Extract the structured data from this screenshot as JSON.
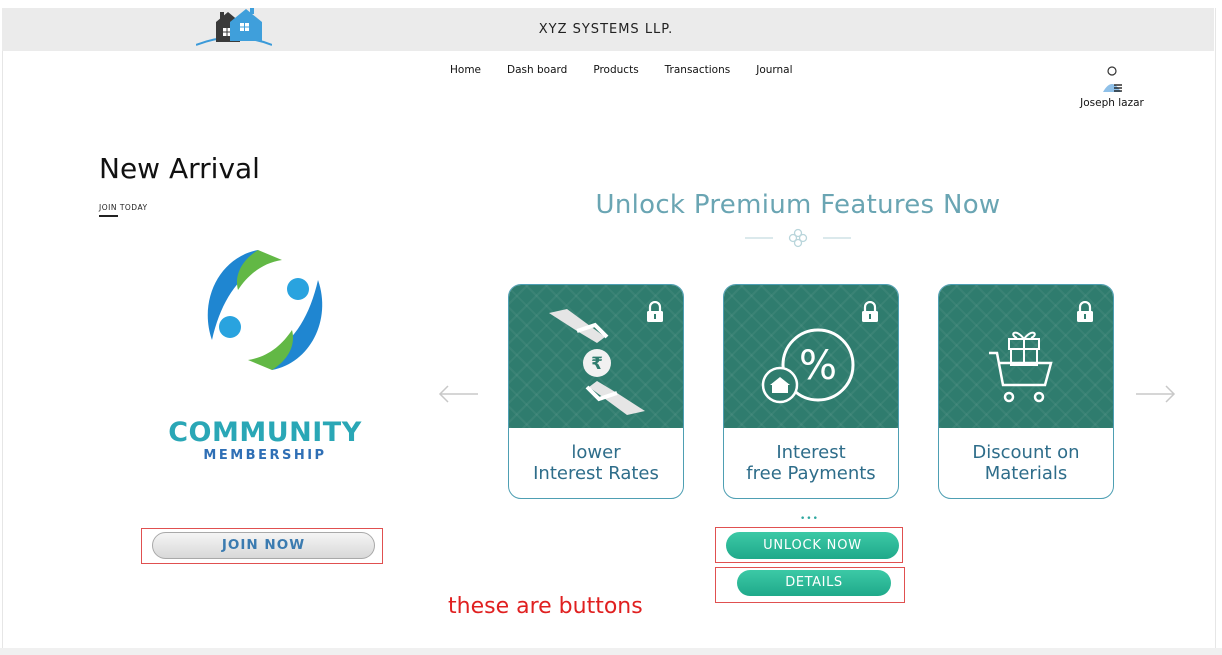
{
  "header": {
    "company_name": "XYZ  SYSTEMS LLP.",
    "logo_icon": "house-logo-icon",
    "background": "#ebebeb"
  },
  "nav": {
    "items": [
      "Home",
      "Dash board",
      "Products",
      "Transactions",
      "Journal"
    ]
  },
  "user": {
    "name": "Joseph lazar",
    "icon": "user-avatar-icon"
  },
  "new_arrival": {
    "title": "New Arrival",
    "subtitle": "JOIN TODAY",
    "logo_line1": "COMMUNITY",
    "logo_line2": "MEMBERSHIP",
    "join_button": "JOIN NOW"
  },
  "premium": {
    "title": "Unlock Premium Features Now",
    "cards": [
      {
        "line1": "lower",
        "line2": "Interest Rates",
        "icon": "money-hands-icon",
        "locked": true
      },
      {
        "line1": "Interest",
        "line2": "free Payments",
        "icon": "percent-icon",
        "locked": true
      },
      {
        "line1": "Discount on",
        "line2": "Materials",
        "icon": "gift-cart-icon",
        "locked": true
      }
    ],
    "pagination_dots": "•••",
    "unlock_button": "UNLOCK NOW",
    "details_button": "DETAILS",
    "prev_icon": "arrow-left-icon",
    "next_icon": "arrow-right-icon"
  },
  "annotation": "these are buttons",
  "colors": {
    "teal_card": "#2f7c6e",
    "button_green": "#2ab896",
    "title_blue": "#6aa5b3",
    "annotation_red": "#e02020"
  }
}
